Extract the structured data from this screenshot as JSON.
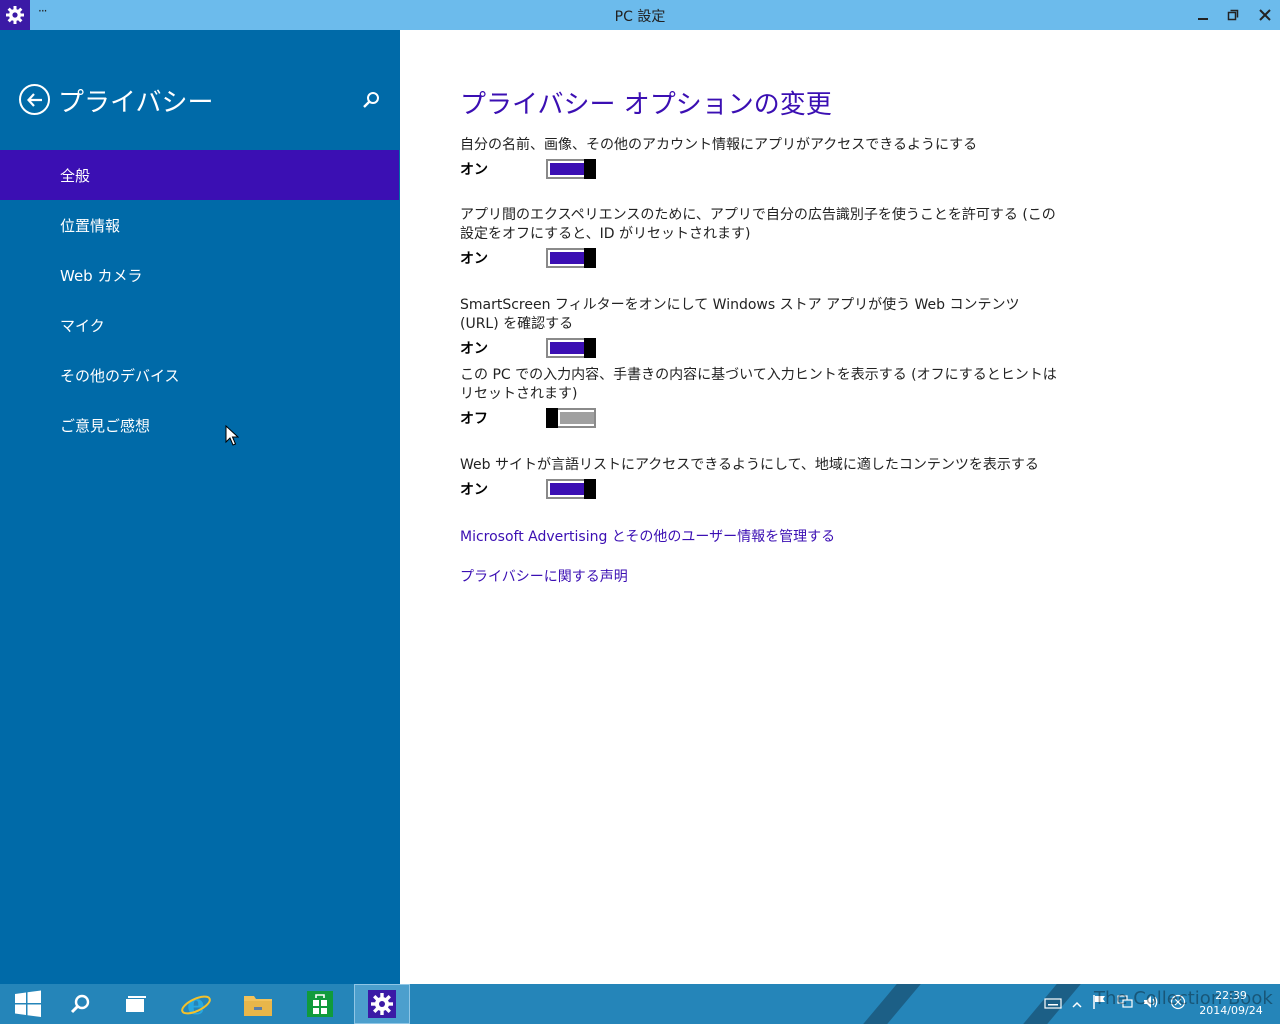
{
  "window": {
    "title": "PC 設定",
    "menu_label": "···",
    "app_icon": "gear-icon",
    "minimize_icon": "minimize-icon",
    "maximize_icon": "restore-icon",
    "close_icon": "close-icon"
  },
  "sidebar": {
    "title": "プライバシー",
    "back_icon": "back-arrow-icon",
    "search_icon": "search-icon",
    "items": [
      {
        "label": "全般",
        "active": true
      },
      {
        "label": "位置情報"
      },
      {
        "label": "Web カメラ"
      },
      {
        "label": "マイク"
      },
      {
        "label": "その他のデバイス"
      },
      {
        "label": "ご意見ご感想"
      }
    ]
  },
  "main": {
    "title": "プライバシー オプションの変更",
    "settings": [
      {
        "description": "自分の名前、画像、その他のアカウント情報にアプリがアクセスできるようにする",
        "state": "オン",
        "on": true
      },
      {
        "description": "アプリ間のエクスペリエンスのために、アプリで自分の広告識別子を使うことを許可する (この設定をオフにすると、ID がリセットされます)",
        "state": "オン",
        "on": true
      },
      {
        "description": "SmartScreen フィルターをオンにして Windows ストア アプリが使う Web コンテンツ (URL) を確認する",
        "state": "オン",
        "on": true
      },
      {
        "description": "この PC での入力内容、手書きの内容に基づいて入力ヒントを表示する (オフにするとヒントはリセットされます)",
        "state": "オフ",
        "on": false
      },
      {
        "description": "Web サイトが言語リストにアクセスできるようにして、地域に適したコンテンツを表示する",
        "state": "オン",
        "on": true
      }
    ],
    "links": [
      "Microsoft Advertising とその他のユーザー情報を管理する",
      "プライバシーに関する声明"
    ]
  },
  "taskbar": {
    "apps": [
      "start-icon",
      "search-icon",
      "task-view-icon",
      "internet-explorer-icon",
      "file-explorer-icon",
      "store-icon",
      "settings-icon"
    ],
    "active_app": "settings-icon",
    "tray_icons": [
      "keyboard-icon",
      "show-hidden-icons-icon",
      "flag-icon",
      "network-icon",
      "volume-icon",
      "power-icon"
    ],
    "time": "22:39",
    "date": "2014/09/24",
    "watermark": "The Collection Book"
  },
  "colors": {
    "accent": "#3b0fb3",
    "sidebar_bg": "#006aa8",
    "titlebar_bg": "#6cbbec",
    "taskbar_bg": "#2585b9"
  }
}
